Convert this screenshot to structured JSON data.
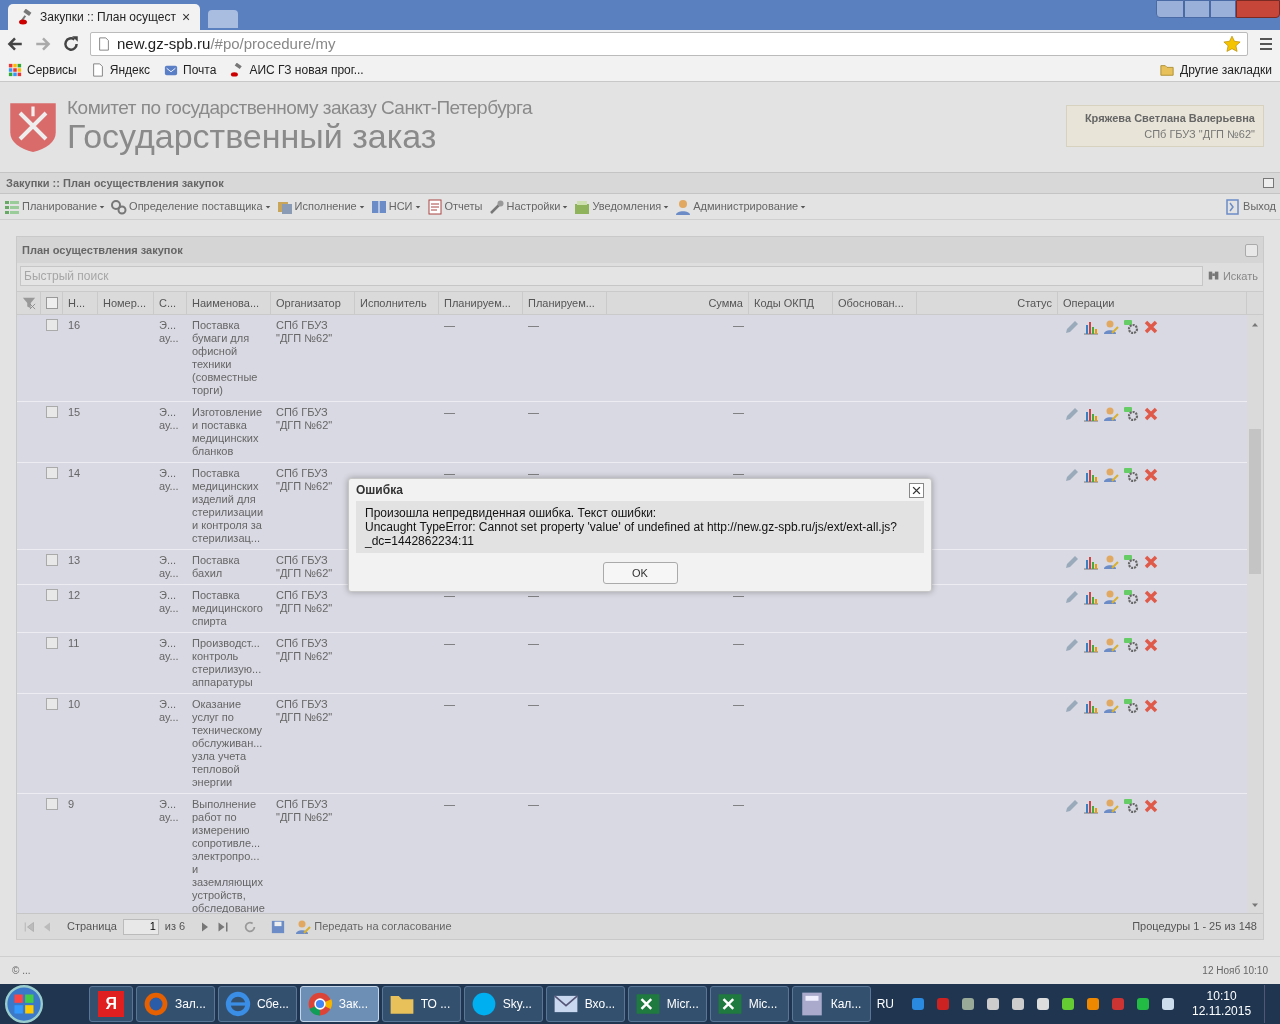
{
  "browser": {
    "tab": {
      "title": "Закупки :: План осущест",
      "close": "×"
    },
    "address": {
      "host": "new.gz-spb.ru",
      "path": "/#po/procedure/my"
    },
    "bookmarks": [
      {
        "kind": "apps",
        "label": "Сервисы"
      },
      {
        "kind": "page",
        "label": "Яндекс"
      },
      {
        "kind": "mail",
        "label": "Почта"
      },
      {
        "kind": "tool",
        "label": "АИС ГЗ новая прог..."
      }
    ],
    "other_bookmarks": "Другие закладки"
  },
  "header": {
    "subtitle": "Комитет по государственному заказу Санкт-Петербурга",
    "title": "Государственный заказ",
    "user": {
      "name": "Кряжева Светлана Валерьевна",
      "org": "СПб ГБУЗ \"ДГП №62\""
    }
  },
  "section_title": "Закупки :: План осуществления закупок",
  "menu": [
    {
      "kind": "plan",
      "label": "Планирование",
      "dropdown": true
    },
    {
      "kind": "gears",
      "label": "Определение поставщика",
      "dropdown": true
    },
    {
      "kind": "exec",
      "label": "Исполнение",
      "dropdown": true
    },
    {
      "kind": "book",
      "label": "НСИ",
      "dropdown": true
    },
    {
      "kind": "report",
      "label": "Отчеты",
      "dropdown": false
    },
    {
      "kind": "wrench",
      "label": "Настройки",
      "dropdown": true
    },
    {
      "kind": "notify",
      "label": "Уведомления",
      "dropdown": true
    },
    {
      "kind": "admin",
      "label": "Администрирование",
      "dropdown": true
    }
  ],
  "logout": "Выход",
  "panel": {
    "title": "План осуществления закупок",
    "search": {
      "placeholder": "Быстрый поиск",
      "button": "Искать"
    },
    "select_all_checked": false,
    "columns": [
      "Н...",
      "Номер...",
      "С...",
      "Наименова...",
      "Организатор",
      "Исполнитель",
      "Планируем...",
      "Планируем...",
      "Сумма",
      "Коды ОКПД",
      "Обоснован...",
      "Статус",
      "Операции"
    ],
    "rows": [
      {
        "checked": false,
        "n": "16",
        "c": "Э...\nау...",
        "name": "Поставка\nбумаги для\nофисной\nтехники\n(совместные\nторги)",
        "org": "СПб ГБУЗ\n\"ДГП №62\"",
        "plan1": "—",
        "plan2": "—",
        "sum": "—"
      },
      {
        "checked": false,
        "n": "15",
        "c": "Э...\nау...",
        "name": "Изготовление\nи поставка\nмедицинских\nбланков",
        "org": "СПб ГБУЗ\n\"ДГП №62\"",
        "plan1": "—",
        "plan2": "—",
        "sum": "—"
      },
      {
        "checked": false,
        "n": "14",
        "c": "Э...\nау...",
        "name": "Поставка\nмедицинских\nизделий для\nстерилизации\nи контроля за\nстерилизац...",
        "org": "СПб ГБУЗ\n\"ДГП №62\"",
        "plan1": "—",
        "plan2": "—",
        "sum": "—"
      },
      {
        "checked": false,
        "n": "13",
        "c": "Э...\nау...",
        "name": "Поставка\nбахил",
        "org": "СПб ГБУЗ\n\"ДГП №62\""
      },
      {
        "checked": false,
        "n": "12",
        "c": "Э...\nау...",
        "name": "Поставка\nмедицинского\nспирта",
        "org": "СПб ГБУЗ\n\"ДГП №62\"",
        "plan1": "—",
        "plan2": "—",
        "sum": "—"
      },
      {
        "checked": false,
        "n": "11",
        "c": "Э...\nау...",
        "name": "Производст...\nконтроль\nстерилизую...\nаппаратуры",
        "org": "СПб ГБУЗ\n\"ДГП №62\"",
        "plan1": "—",
        "plan2": "—",
        "sum": "—"
      },
      {
        "checked": false,
        "n": "10",
        "c": "Э...\nау...",
        "name": "Оказание\nуслуг по\nтехническому\nобслуживан...\nузла учета\nтепловой\nэнергии",
        "org": "СПб ГБУЗ\n\"ДГП №62\"",
        "plan1": "—",
        "plan2": "—",
        "sum": "—"
      },
      {
        "checked": false,
        "n": "9",
        "c": "Э...\nау...",
        "name": "Выполнение\nработ по\nизмерению\nсопротивле...\nэлектропро...\nи\nзаземляющих\nустройств,\nобследование",
        "org": "СПб ГБУЗ\n\"ДГП №62\"",
        "plan1": "—",
        "plan2": "—",
        "sum": "—"
      }
    ],
    "pager": {
      "page_label": "Страница",
      "page": "1",
      "of": "из 6",
      "send": "Передать на согласование",
      "summary": "Процедуры 1 - 25 из 148"
    }
  },
  "footer": {
    "left": "© ...",
    "right": "12 Нояб 10:10"
  },
  "dialog": {
    "title": "Ошибка",
    "message": "Произошла непредвиденная ошибка. Текст ошибки:\nUncaught TypeError: Cannot set property 'value' of undefined at http://new.gz-spb.ru/js/ext/ext-all.js?\n_dc=1442862234:11",
    "button": "OK"
  },
  "taskbar": {
    "items": [
      {
        "kind": "yandex",
        "label": "Я",
        "selected": false
      },
      {
        "kind": "firefox",
        "label": "Зал...",
        "selected": false
      },
      {
        "kind": "ie",
        "label": "Сбе...",
        "selected": false
      },
      {
        "kind": "chrome",
        "label": "Зак...",
        "selected": true
      },
      {
        "kind": "folder",
        "label": "ТО ...",
        "selected": false
      },
      {
        "kind": "skype",
        "label": "Sky...",
        "selected": false
      },
      {
        "kind": "mail",
        "label": "Вхо...",
        "selected": false
      },
      {
        "kind": "excel",
        "label": "Micr...",
        "selected": false
      },
      {
        "kind": "excel",
        "label": "Mic...",
        "selected": false
      },
      {
        "kind": "calc",
        "label": "Кал...",
        "selected": false
      }
    ],
    "lang": "RU",
    "time": "10:10",
    "date": "12.11.2015"
  }
}
